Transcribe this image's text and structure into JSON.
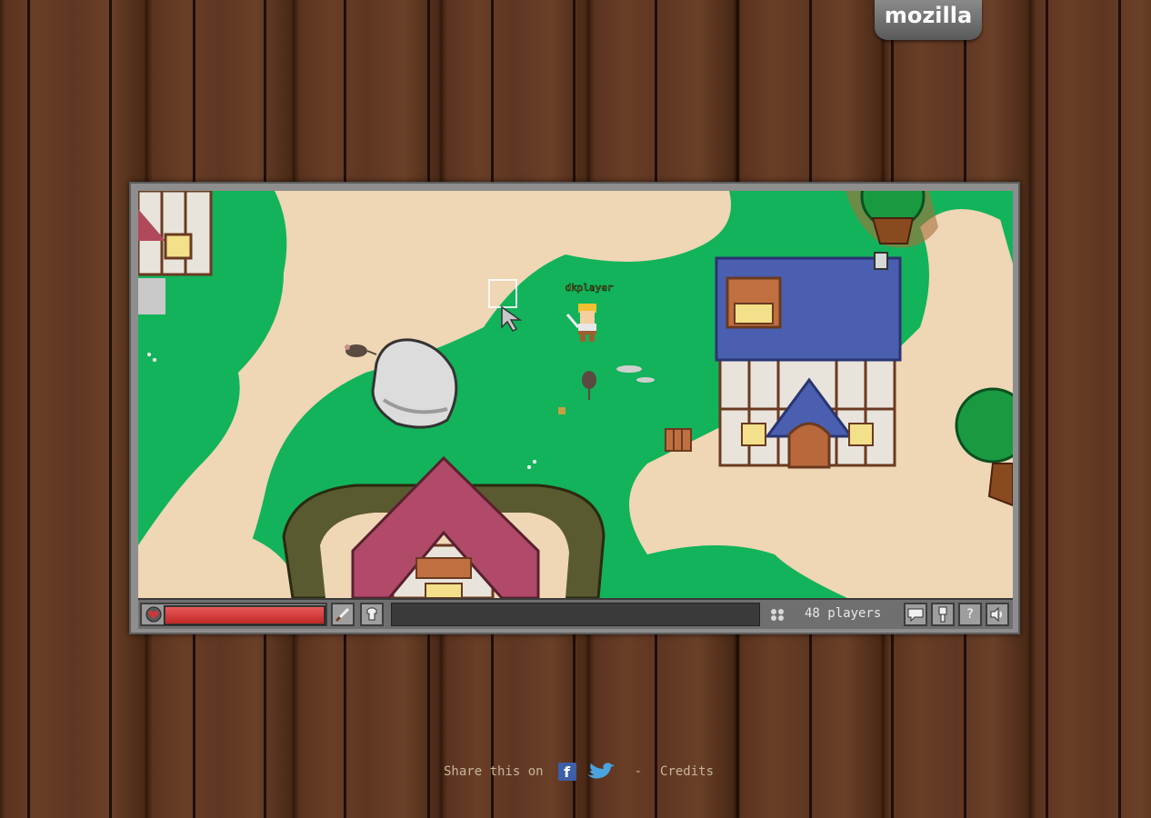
{
  "brand": {
    "mozilla_tab": "mozilla"
  },
  "game": {
    "player_name": "dkplayer",
    "health_fraction": 1.0,
    "player_count_text": "48 players"
  },
  "hud": {
    "icons": [
      "heart-icon",
      "sword-icon",
      "armor-icon",
      "players-icon",
      "chat-icon",
      "achievements-icon",
      "help-icon",
      "sound-icon"
    ],
    "help_glyph": "?"
  },
  "footer": {
    "share_text": "Share this on",
    "separator": "-",
    "credits": "Credits",
    "facebook_glyph": "f"
  },
  "colors": {
    "grass": "#12b35a",
    "sand": "#f0d8b8",
    "health": "#d43434",
    "wood": "#5a3320"
  }
}
